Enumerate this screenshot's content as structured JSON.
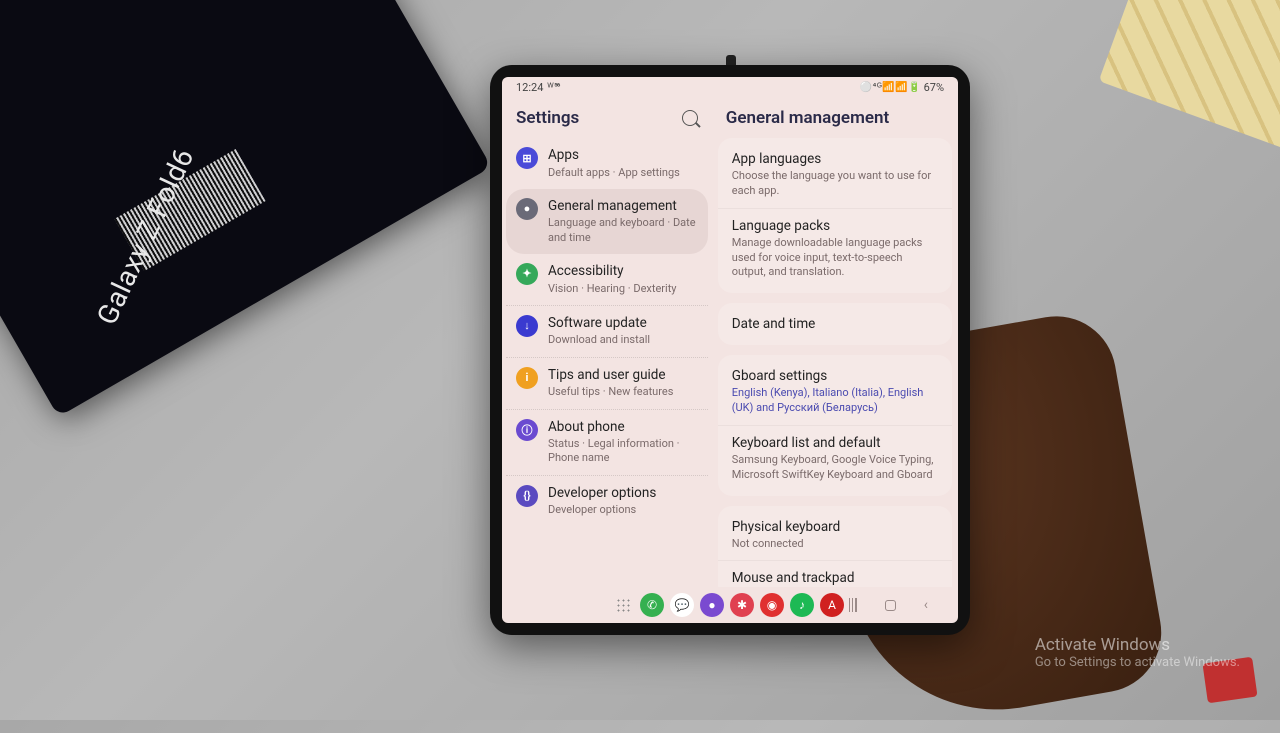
{
  "device_label": "Galaxy Z Fold6",
  "watermark": {
    "title": "Activate Windows",
    "sub": "Go to Settings to activate Windows."
  },
  "statusbar": {
    "time": "12:24",
    "indicators": "ᵂ ⁵⁶",
    "battery": "67%",
    "icons": "⚪ ⁴ ᴳ 📶 📶 🔋"
  },
  "left": {
    "title": "Settings",
    "items": [
      {
        "id": "apps",
        "label": "Apps",
        "sub": "Default apps · App settings",
        "color": "#4a4ad8",
        "glyph": "⊞"
      },
      {
        "id": "general",
        "label": "General management",
        "sub": "Language and keyboard · Date and time",
        "color": "#6a6a78",
        "glyph": "●",
        "selected": true
      },
      {
        "id": "accessibility",
        "label": "Accessibility",
        "sub": "Vision · Hearing · Dexterity",
        "color": "#35a85a",
        "glyph": "✦"
      },
      {
        "id": "software-update",
        "label": "Software update",
        "sub": "Download and install",
        "color": "#3a3ad0",
        "glyph": "↓"
      },
      {
        "id": "tips",
        "label": "Tips and user guide",
        "sub": "Useful tips · New features",
        "color": "#f0a020",
        "glyph": "i"
      },
      {
        "id": "about",
        "label": "About phone",
        "sub": "Status · Legal information · Phone name",
        "color": "#6a4ad0",
        "glyph": "ⓘ"
      },
      {
        "id": "developer",
        "label": "Developer options",
        "sub": "Developer options",
        "color": "#5a4ac0",
        "glyph": "{}"
      }
    ]
  },
  "right": {
    "title": "General management",
    "groups": [
      [
        {
          "id": "app-languages",
          "title": "App languages",
          "sub": "Choose the language you want to use for each app."
        },
        {
          "id": "language-packs",
          "title": "Language packs",
          "sub": "Manage downloadable language packs used for voice input, text-to-speech output, and translation."
        }
      ],
      [
        {
          "id": "date-time",
          "title": "Date and time",
          "sub": ""
        }
      ],
      [
        {
          "id": "gboard",
          "title": "Gboard settings",
          "sub": "English (Kenya), Italiano (Italia), English (UK) and Русский (Беларусь)",
          "accent": true
        },
        {
          "id": "keyboard-list",
          "title": "Keyboard list and default",
          "sub": "Samsung Keyboard, Google Voice Typing, Microsoft SwiftKey Keyboard and Gboard"
        }
      ],
      [
        {
          "id": "physical-keyboard",
          "title": "Physical keyboard",
          "sub": "Not connected"
        },
        {
          "id": "mouse-trackpad",
          "title": "Mouse and trackpad",
          "sub": ""
        }
      ]
    ]
  },
  "dock": {
    "apps": [
      {
        "id": "phone",
        "color": "#35b050",
        "glyph": "✆"
      },
      {
        "id": "messages",
        "color": "#ffffff",
        "glyph": "💬",
        "fg": "#4a6ad0"
      },
      {
        "id": "app3",
        "color": "#7a4ad0",
        "glyph": "●"
      },
      {
        "id": "app4",
        "color": "#e04050",
        "glyph": "✱"
      },
      {
        "id": "app5",
        "color": "#e03030",
        "glyph": "◉"
      },
      {
        "id": "spotify",
        "color": "#1db954",
        "glyph": "♪"
      },
      {
        "id": "acrobat",
        "color": "#d02020",
        "glyph": "A"
      }
    ]
  }
}
